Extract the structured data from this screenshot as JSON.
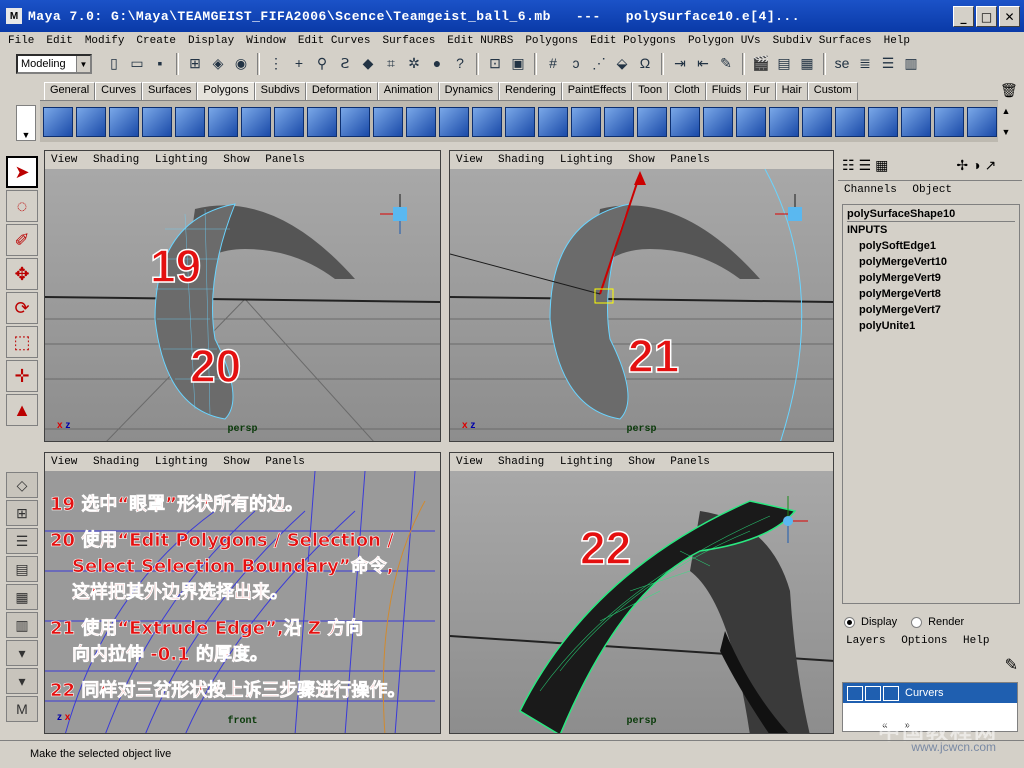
{
  "window": {
    "title": "Maya 7.0: G:\\Maya\\TEAMGEIST_FIFA2006\\Scence\\Teamgeist_ball_6.mb   ---   polySurface10.e[4]...",
    "minimize": "_",
    "maximize": "□",
    "close": "✕"
  },
  "menus": [
    "File",
    "Edit",
    "Modify",
    "Create",
    "Display",
    "Window",
    "Edit Curves",
    "Surfaces",
    "Edit NURBS",
    "Polygons",
    "Edit Polygons",
    "Polygon UVs",
    "Subdiv Surfaces",
    "Help"
  ],
  "statusline": {
    "mode": "Modeling",
    "mode_arrow": "▼"
  },
  "shelf_tabs": [
    "General",
    "Curves",
    "Surfaces",
    "Polygons",
    "Subdivs",
    "Deformation",
    "Animation",
    "Dynamics",
    "Rendering",
    "PaintEffects",
    "Toon",
    "Cloth",
    "Fluids",
    "Fur",
    "Hair",
    "Custom"
  ],
  "active_shelf_tab": "Polygons",
  "viewport_menu": [
    "View",
    "Shading",
    "Lighting",
    "Show",
    "Panels"
  ],
  "viewports": {
    "tl": {
      "camera": "persp",
      "numbers": [
        "19",
        "20"
      ]
    },
    "tr": {
      "camera": "persp",
      "numbers": [
        "21"
      ]
    },
    "bl": {
      "camera": "front"
    },
    "br": {
      "camera": "persp",
      "numbers": [
        "22"
      ]
    }
  },
  "annotations": {
    "line1": "19 选中“眼罩”形状所有的边。",
    "line2a": "20 使用“Edit Polygons / Selection /",
    "line2b": "Select Selection Boundary”命令,",
    "line2c": "这样把其外边界选择出来。",
    "line3a": "21 使用“Extrude Edge”,沿 Z 方向",
    "line3b": "向内拉伸 -0.1 的厚度。",
    "line4": "22 同样对三岔形状按上诉三步骤进行操作。"
  },
  "channel_box": {
    "menu": [
      "Channels",
      "Object"
    ],
    "shape": "polySurfaceShape10",
    "inputs_label": "INPUTS",
    "nodes": [
      "polySoftEdge1",
      "polyMergeVert10",
      "polyMergeVert9",
      "polyMergeVert8",
      "polyMergeVert7",
      "polyUnite1"
    ]
  },
  "layer_editor": {
    "display": "Display",
    "render": "Render",
    "menu": [
      "Layers",
      "Options",
      "Help"
    ],
    "layer_name": "Curvers"
  },
  "axis": {
    "x": "x",
    "y": "y",
    "z": "z"
  },
  "helpline": "Make the selected object live",
  "watermark": "中国教程网",
  "watermark_url": "www.jcwcn.com"
}
